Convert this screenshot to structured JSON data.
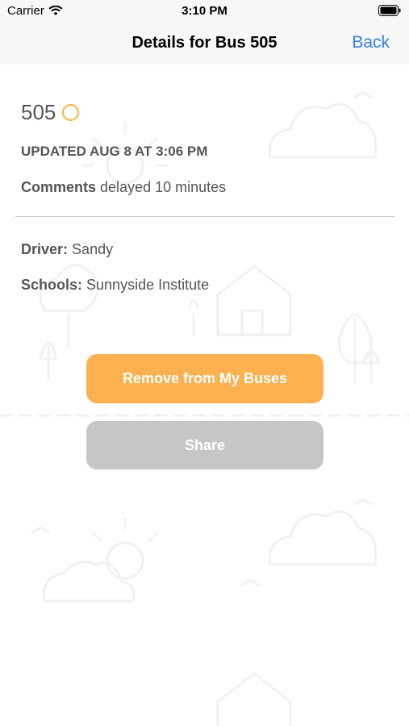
{
  "status_bar": {
    "carrier": "Carrier",
    "time": "3:10 PM"
  },
  "nav": {
    "title": "Details for Bus 505",
    "back_label": "Back"
  },
  "bus": {
    "number": "505",
    "status_color": "#f5b23a",
    "updated": "UPDATED AUG 8 AT 3:06 PM",
    "comments_label": "Comments",
    "comments_value": "delayed 10 minutes",
    "driver_label": "Driver:",
    "driver_value": "Sandy",
    "schools_label": "Schools:",
    "schools_value": "Sunnyside Institute"
  },
  "actions": {
    "remove_label": "Remove from My Buses",
    "share_label": "Share"
  },
  "colors": {
    "accent": "#fbb150",
    "link": "#2f7fe6",
    "disabled": "#c6c6c6"
  }
}
